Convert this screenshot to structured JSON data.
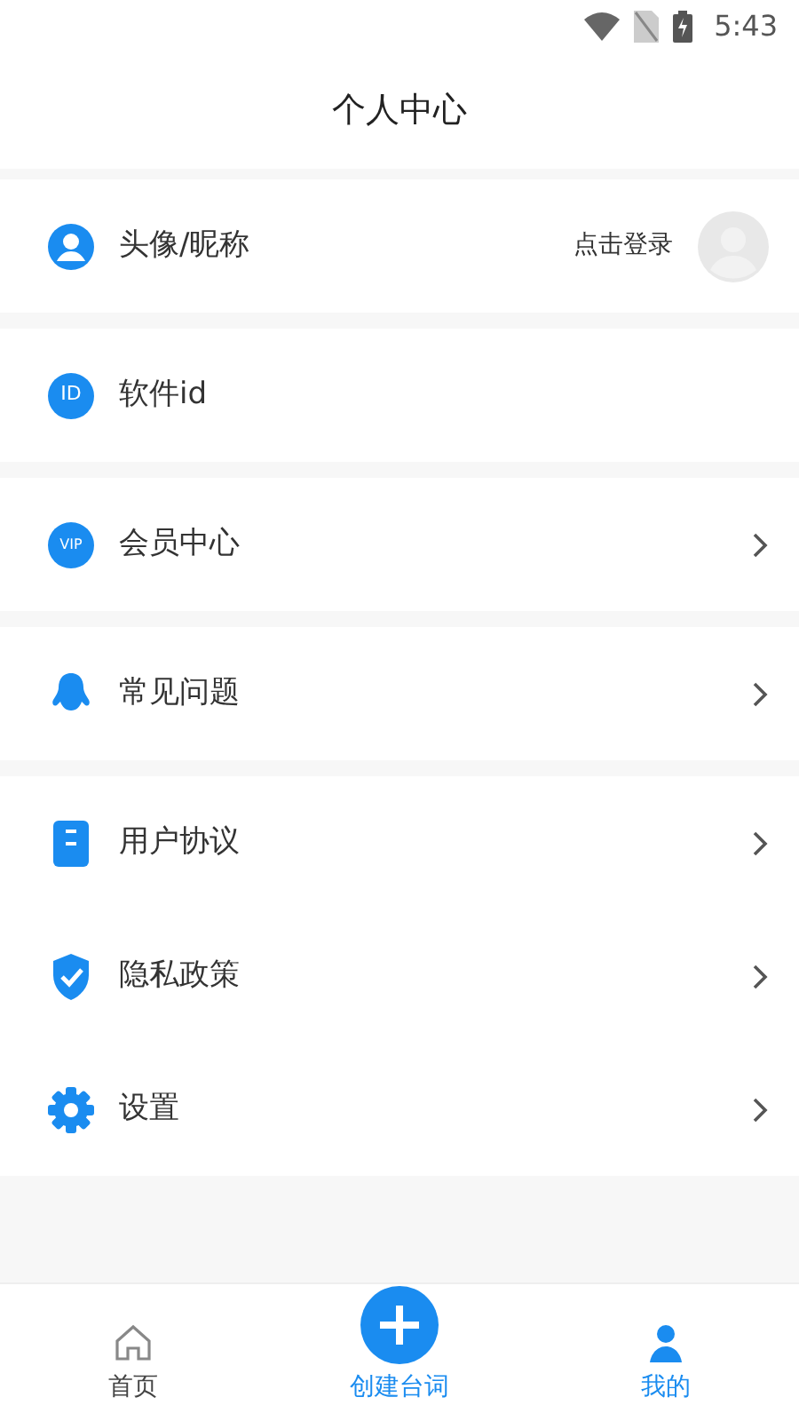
{
  "status_bar": {
    "time": "5:43"
  },
  "title": "个人中心",
  "groups": [
    {
      "rows": [
        {
          "kind": "login",
          "label": "头像/昵称",
          "hint": "点击登录"
        }
      ]
    },
    {
      "rows": [
        {
          "kind": "plain",
          "label": "软件id",
          "badge": "ID"
        }
      ]
    },
    {
      "rows": [
        {
          "kind": "link",
          "label": "会员中心",
          "badge": "VIP"
        }
      ]
    },
    {
      "rows": [
        {
          "kind": "link",
          "label": "常见问题"
        }
      ]
    },
    {
      "rows": [
        {
          "kind": "link",
          "label": "用户协议"
        },
        {
          "kind": "link",
          "label": "隐私政策"
        },
        {
          "kind": "link",
          "label": "设置"
        }
      ]
    }
  ],
  "bottom_nav": [
    {
      "kind": "tab",
      "label": "首页",
      "selected": false
    },
    {
      "kind": "action",
      "label": "创建台词"
    },
    {
      "kind": "tab",
      "label": "我的",
      "selected": true
    }
  ]
}
